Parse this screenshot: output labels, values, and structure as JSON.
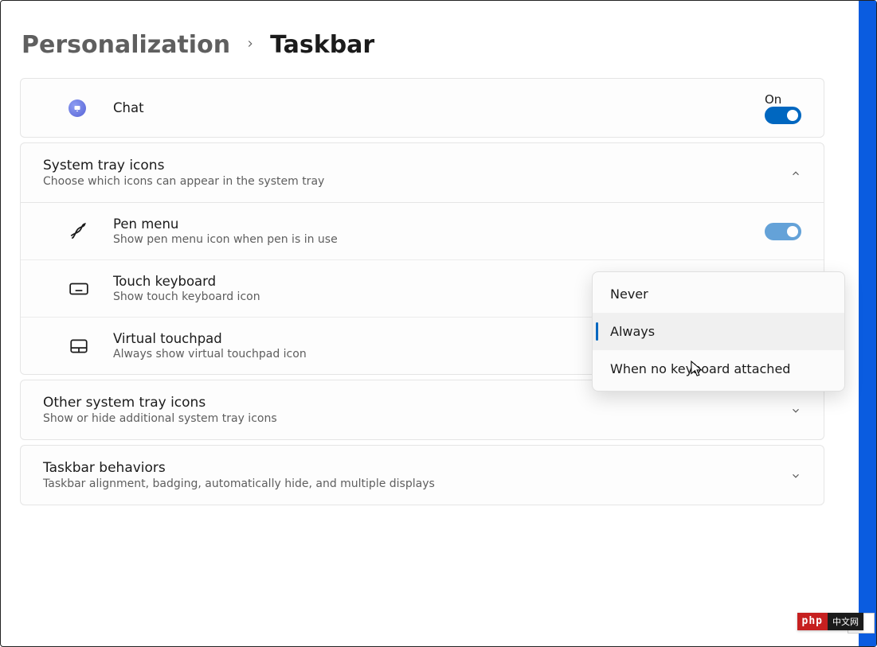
{
  "breadcrumb": {
    "parent": "Personalization",
    "current": "Taskbar"
  },
  "chat": {
    "label": "Chat",
    "state": "On",
    "on": true
  },
  "system_tray": {
    "title": "System tray icons",
    "subtitle": "Choose which icons can appear in the system tray",
    "expanded": true,
    "items": [
      {
        "title": "Pen menu",
        "subtitle": "Show pen menu icon when pen is in use",
        "on": true
      },
      {
        "title": "Touch keyboard",
        "subtitle": "Show touch keyboard icon"
      },
      {
        "title": "Virtual touchpad",
        "subtitle": "Always show virtual touchpad icon",
        "on": false
      }
    ]
  },
  "other_tray": {
    "title": "Other system tray icons",
    "subtitle": "Show or hide additional system tray icons",
    "expanded": false
  },
  "behaviors": {
    "title": "Taskbar behaviors",
    "subtitle": "Taskbar alignment, badging, automatically hide, and multiple displays",
    "expanded": false
  },
  "dropdown": {
    "options": [
      "Never",
      "Always",
      "When no keyboard attached"
    ],
    "selected": "Always"
  },
  "badge": {
    "left": "php",
    "right": "中文网"
  }
}
